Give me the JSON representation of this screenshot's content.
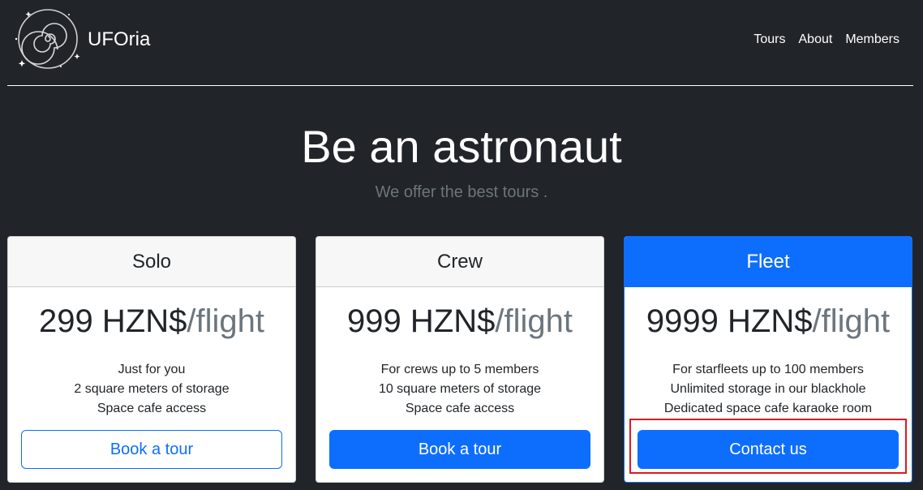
{
  "header": {
    "brand": "UFOria",
    "logo_icon": "spiral-galaxy-icon",
    "nav": [
      {
        "label": "Tours"
      },
      {
        "label": "About"
      },
      {
        "label": "Members"
      }
    ]
  },
  "hero": {
    "title": "Be an astronaut",
    "subtitle": "We offer the best tours ."
  },
  "plans": [
    {
      "name": "Solo",
      "price": "299 HZN$",
      "unit": "/flight",
      "features": [
        "Just for you",
        "2 square meters of storage",
        "Space cafe access"
      ],
      "button": "Book a tour"
    },
    {
      "name": "Crew",
      "price": "999 HZN$",
      "unit": "/flight",
      "features": [
        "For crews up to 5 members",
        "10 square meters of storage",
        "Space cafe access"
      ],
      "button": "Book a tour"
    },
    {
      "name": "Fleet",
      "price": "9999 HZN$",
      "unit": "/flight",
      "features": [
        "For starfleets up to 100 members",
        "Unlimited storage in our blackhole",
        "Dedicated space cafe karaoke room"
      ],
      "button": "Contact us"
    }
  ],
  "colors": {
    "background": "#212529",
    "primary": "#0d6efd",
    "muted": "#6c757d",
    "highlight": "#e0191e"
  }
}
